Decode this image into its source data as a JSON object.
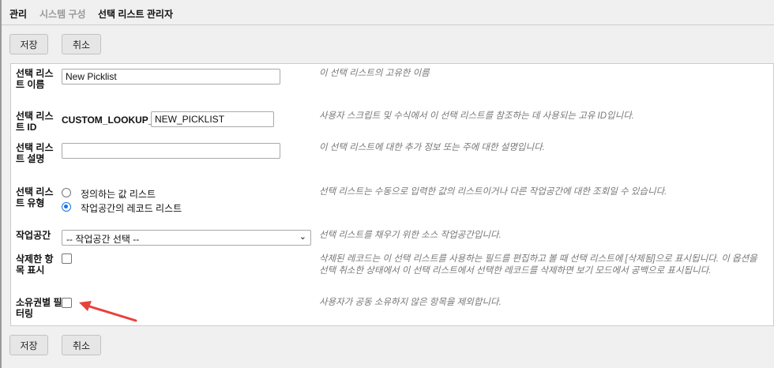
{
  "breadcrumb": {
    "items": [
      "관리",
      "시스템 구성",
      "선택 리스트 관리자"
    ]
  },
  "toolbar": {
    "save_label": "저장",
    "cancel_label": "취소"
  },
  "form": {
    "name": {
      "label": "선택 리스트 이름",
      "value": "New Picklist",
      "description": "이 선택 리스트의 고유한 이름"
    },
    "id": {
      "label": "선택 리스트 ID",
      "prefix": "CUSTOM_LOOKUP_",
      "value": "NEW_PICKLIST",
      "description": "사용자 스크립트 및 수식에서 이 선택 리스트를 참조하는 데 사용되는 고유 ID입니다."
    },
    "desc": {
      "label": "선택 리스트 설명",
      "value": "",
      "description": "이 선택 리스트에 대한 추가 정보 또는 주에 대한 설명입니다."
    },
    "type": {
      "label": "선택 리스트 유형",
      "options": [
        "정의하는 값 리스트",
        "작업공간의 레코드 리스트"
      ],
      "selected": 1,
      "description": "선택 리스트는 수동으로 입력한 값의 리스트이거나 다른 작업공간에 대한 조회일 수 있습니다."
    },
    "workspace": {
      "label": "작업공간",
      "selected": "-- 작업공간 선택 --",
      "description": "선택 리스트를 채우기 위한 소스 작업공간입니다."
    },
    "show_deleted": {
      "label": "삭제한 항목 표시",
      "checked": false,
      "description": "삭제된 레코드는 이 선택 리스트를 사용하는 필드를 편집하고 볼 때 선택 리스트에 [삭제됨]으로 표시됩니다. 이 옵션을 선택 취소한 상태에서 이 선택 리스트에서 선택한 레코드를 삭제하면 보기 모드에서 공백으로 표시됩니다."
    },
    "filter_owner": {
      "label": "소유권별 필터링",
      "checked": false,
      "description": "사용자가 공동 소유하지 않은 항목을 제외합니다."
    }
  },
  "colors": {
    "accent": "#1a73e8",
    "annotation_arrow": "#e8413c"
  }
}
